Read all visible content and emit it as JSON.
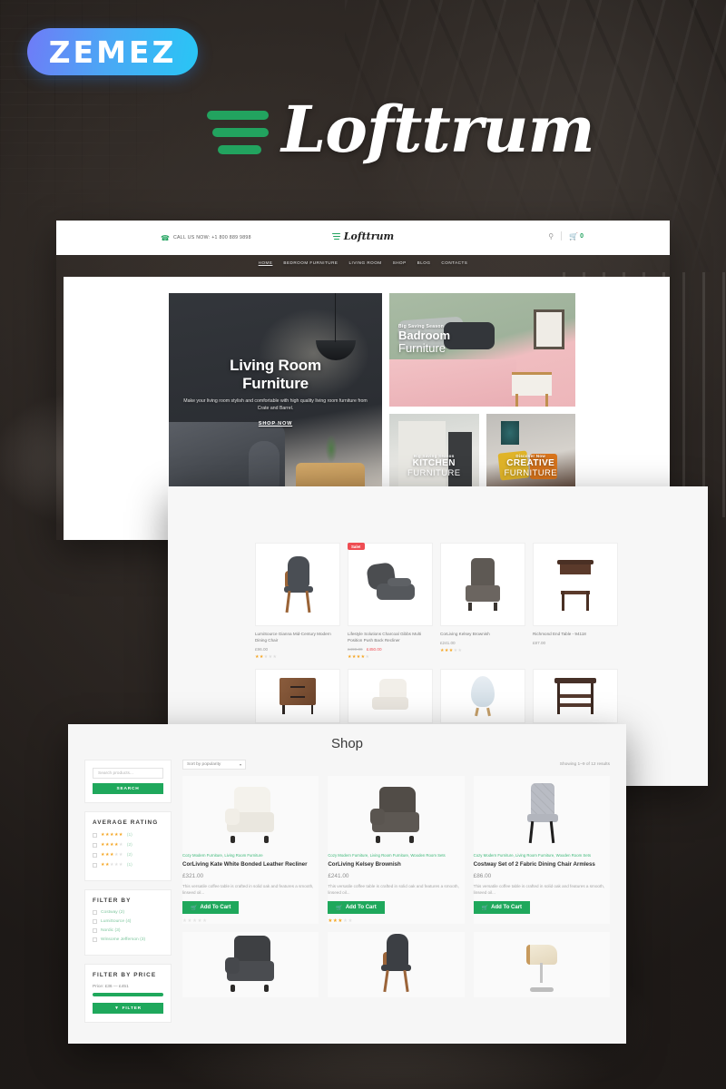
{
  "brand": {
    "vendor_logo": "ZEMEZ",
    "template_name": "Lofttrum",
    "logo_icon": "hamburger-bars-icon"
  },
  "site_header": {
    "phone_icon": "phone-icon",
    "phone_text": "CALL US NOW: +1 800 889 9898",
    "logo_text": "Lofttrum",
    "search_icon": "search-icon",
    "cart_icon": "cart-icon",
    "cart_count": "0",
    "nav": [
      {
        "label": "HOME",
        "active": true
      },
      {
        "label": "BEDROOM FURNITURE",
        "active": false
      },
      {
        "label": "LIVING ROOM",
        "active": false
      },
      {
        "label": "SHOP",
        "active": false
      },
      {
        "label": "BLOG",
        "active": false
      },
      {
        "label": "CONTACTS",
        "active": false
      }
    ]
  },
  "hero": {
    "main": {
      "title_line1": "Living Room",
      "title_line2": "Furniture",
      "description": "Make your living room stylish and comfortable with high quality living room furniture from Crate and Barrel.",
      "cta": "SHOP NOW"
    },
    "tiles": [
      {
        "eyebrow": "Big Saving Season",
        "title_bold": "Badroom",
        "title_thin": "Furniture"
      },
      {
        "eyebrow": "Big Saving Season",
        "title_bold": "KITCHEN",
        "title_thin": "FURNITURE"
      },
      {
        "eyebrow": "Discover Now",
        "title_bold": "CREATIVE",
        "title_thin": "FURNITURE"
      }
    ]
  },
  "catalog": {
    "row1": [
      {
        "name": "LumiSource Gianna Mid-Century Modern Dining Chair",
        "price": "£96.00",
        "old_price": "",
        "sale": false,
        "badge": "",
        "stars_filled": 2,
        "art": "dining-chair"
      },
      {
        "name": "Lifestyle Solutions Charcoal Gibbs Multi Position Push Back Recliner",
        "price": "£450.00",
        "old_price": "£499.00",
        "sale": true,
        "badge": "Sale!",
        "stars_filled": 4,
        "art": "recliner"
      },
      {
        "name": "CorLiving Kelsey Brownish",
        "price": "£241.00",
        "old_price": "",
        "sale": false,
        "badge": "",
        "stars_filled": 3,
        "art": "armchair"
      },
      {
        "name": "Richmond End Table - 94118",
        "price": "£87.00",
        "old_price": "",
        "sale": false,
        "badge": "",
        "stars_filled": 0,
        "art": "end-table"
      }
    ],
    "row2": [
      {
        "art": "nightstand"
      },
      {
        "art": "white-chair"
      },
      {
        "art": "lamp-shade"
      },
      {
        "art": "dark-table"
      }
    ]
  },
  "shop": {
    "page_title": "Shop",
    "sidebar": {
      "search": {
        "placeholder": "Search products...",
        "button_label": "SEARCH"
      },
      "rating_widget": {
        "title": "AVERAGE RATING",
        "rows": [
          {
            "stars": 5,
            "count": "(1)"
          },
          {
            "stars": 4,
            "count": "(2)"
          },
          {
            "stars": 3,
            "count": "(2)"
          },
          {
            "stars": 2,
            "count": "(1)"
          }
        ]
      },
      "filter_widget": {
        "title": "FILTER BY",
        "options": [
          {
            "label": "Costway (2)"
          },
          {
            "label": "LumiSource (4)"
          },
          {
            "label": "Nordic (3)"
          },
          {
            "label": "Winsome Jefferson (3)"
          }
        ]
      },
      "price_widget": {
        "title": "FILTER BY PRICE",
        "price_range": "Price: £36 — £451",
        "button_label": "FILTER",
        "button_icon": "funnel-icon"
      }
    },
    "toolbar": {
      "sort_value": "Sort by popularity",
      "sort_icon": "chevron-down-icon",
      "results_text": "Showing 1–9 of 12 results"
    },
    "products_row1": [
      {
        "categories": "Cozy Modern Furniture, Living Room Furniture",
        "title": "CorLiving Kate White Bonded Leather Recliner",
        "price": "£321.00",
        "description": "This versatile coffee table is crafted in solid oak and features a smooth, linseed oil...",
        "add_to_cart": "Add To Cart",
        "cart_icon": "cart-icon",
        "stars_filled": 0,
        "art": "leather-recliner-white"
      },
      {
        "categories": "Cozy Modern Furniture, Living Room Furniture, Wooden Room Sets",
        "title": "CorLiving Kelsey Brownish",
        "price": "£241.00",
        "description": "This versatile coffee table is crafted in solid oak and features a smooth, linseed oil...",
        "add_to_cart": "Add To Cart",
        "cart_icon": "cart-icon",
        "stars_filled": 3,
        "art": "leather-recliner-dark"
      },
      {
        "categories": "Cozy Modern Furniture, Living Room Furniture, Wooden Room Sets",
        "title": "Costway Set of 2 Fabric Dining Chair Armless",
        "price": "£86.00",
        "description": "This versatile coffee table is crafted in solid oak and features a smooth, linseed oil...",
        "add_to_cart": "Add To Cart",
        "cart_icon": "cart-icon",
        "stars_filled": 0,
        "art": "tufted-dining-chair"
      }
    ],
    "products_row2": [
      {
        "art": "leather-recliner-charcoal"
      },
      {
        "art": "dining-chair-dark"
      },
      {
        "art": "bar-stool"
      }
    ]
  },
  "colors": {
    "brand_green": "#1fa85c",
    "accent_green": "#22a35f",
    "sale_red": "#ef4d53",
    "star_gold": "#f5a623",
    "zemez_blue": "#28c6f5"
  }
}
